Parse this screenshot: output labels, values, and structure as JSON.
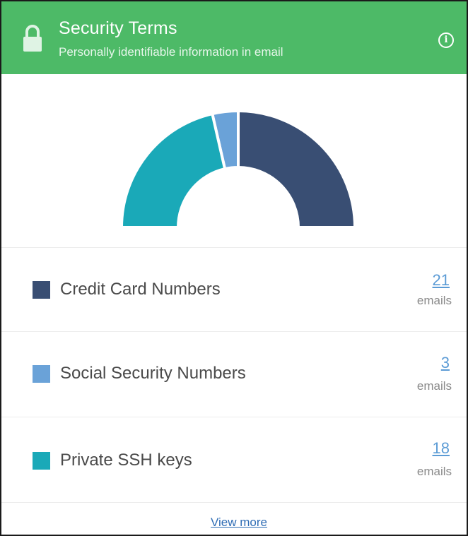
{
  "header": {
    "title": "Security Terms",
    "subtitle": "Personally identifiable information in email",
    "lock_icon": "lock-icon",
    "info_icon": "info-icon",
    "color": "#4dba67"
  },
  "chart_data": {
    "type": "pie",
    "style": "half-donut",
    "categories": [
      "Credit Card Numbers",
      "Social Security Numbers",
      "Private SSH keys"
    ],
    "values": [
      21,
      3,
      18
    ],
    "colors": [
      "#394e73",
      "#6aa2d8",
      "#1aa9b8"
    ]
  },
  "rows": [
    {
      "label": "Credit Card Numbers",
      "count": "21",
      "unit": "emails",
      "color": "#394e73"
    },
    {
      "label": "Social Security Numbers",
      "count": "3",
      "unit": "emails",
      "color": "#6aa2d8"
    },
    {
      "label": "Private SSH keys",
      "count": "18",
      "unit": "emails",
      "color": "#1aa9b8"
    }
  ],
  "footer": {
    "view_more_label": "View more"
  }
}
